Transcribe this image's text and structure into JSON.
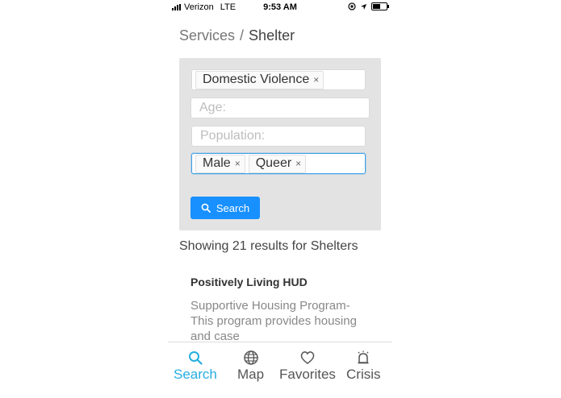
{
  "status_bar": {
    "carrier": "Verizon",
    "network": "LTE",
    "time": "9:53 AM"
  },
  "breadcrumb": {
    "parent": "Services",
    "separator": "/",
    "current": "Shelter"
  },
  "filters": {
    "category_tags": [
      "Domestic Violence"
    ],
    "age_placeholder": "Age:",
    "population_placeholder": "Population:",
    "population_tags": [
      "Male",
      "Queer"
    ],
    "tag_remove_glyph": "×",
    "search_label": "Search"
  },
  "results": {
    "summary": "Showing 21 results for Shelters",
    "items": [
      {
        "title": "Positively Living HUD",
        "description": "Supportive Housing Program- This program provides housing and case"
      }
    ]
  },
  "tabbar": {
    "tabs": [
      {
        "label": "Search",
        "icon": "search-icon",
        "active": true
      },
      {
        "label": "Map",
        "icon": "globe-icon",
        "active": false
      },
      {
        "label": "Favorites",
        "icon": "heart-icon",
        "active": false
      },
      {
        "label": "Crisis",
        "icon": "alarm-icon",
        "active": false
      }
    ]
  },
  "colors": {
    "primary": "#1890ff",
    "active_tab": "#27aee0",
    "card_bg": "#e3e3e3"
  }
}
